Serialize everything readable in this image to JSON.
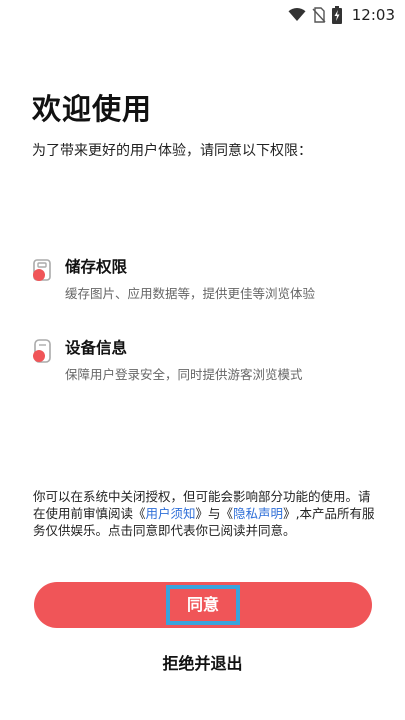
{
  "status_bar": {
    "time": "12:03",
    "icons": [
      "wifi-icon",
      "no-sim-icon",
      "battery-charging-icon"
    ]
  },
  "dialog": {
    "title": "欢迎使用",
    "subtitle": "为了带来更好的用户体验，请同意以下权限：",
    "permissions": [
      {
        "icon": "storage-permission-icon",
        "title": "储存权限",
        "description": "缓存图片、应用数据等，提供更佳等浏览体验"
      },
      {
        "icon": "device-info-icon",
        "title": "设备信息",
        "description": "保障用户登录安全，同时提供游客浏览模式"
      }
    ],
    "notice": {
      "part1": "你可以在系统中关闭授权，但可能会影响部分功能的使用。请在使用前审慎阅读《",
      "link1": "用户须知",
      "part2": "》与《",
      "link2": "隐私声明",
      "part3": "》,本产品所有服务仅供娱乐。点击同意即代表你已阅读并同意。"
    },
    "agree_label": "同意",
    "reject_label": "拒绝并退出"
  },
  "colors": {
    "accent": "#f05558",
    "link": "#2f6fd8",
    "highlight_border": "#3aa3dc"
  }
}
